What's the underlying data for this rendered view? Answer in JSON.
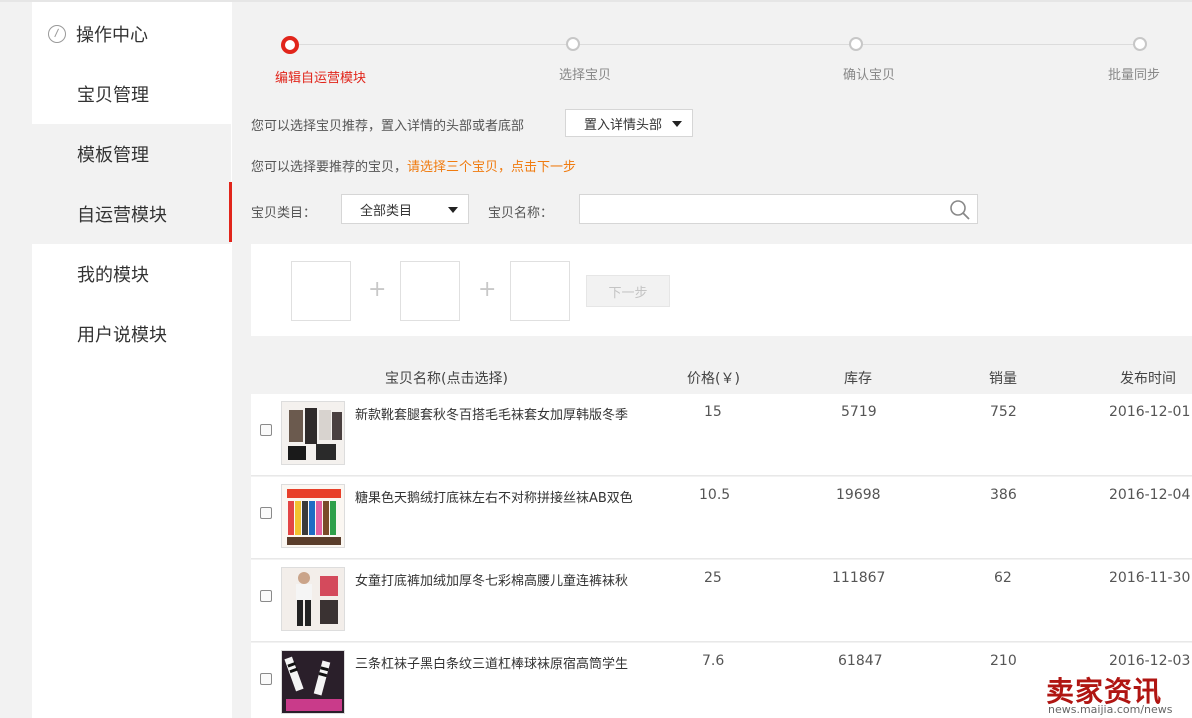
{
  "sidebar": {
    "header": "操作中心",
    "items": [
      {
        "label": "宝贝管理"
      },
      {
        "label": "模板管理"
      },
      {
        "label": "自运营模块"
      },
      {
        "label": "我的模块"
      },
      {
        "label": "用户说模块"
      }
    ],
    "active_item": "自运营模块"
  },
  "steps": [
    {
      "label": "编辑自运营模块",
      "active": true
    },
    {
      "label": "选择宝贝",
      "active": false
    },
    {
      "label": "确认宝贝",
      "active": false
    },
    {
      "label": "批量同步",
      "active": false
    }
  ],
  "placement": {
    "text": "您可以选择宝贝推荐，置入详情的头部或者底部",
    "selected": "置入详情头部"
  },
  "hint": {
    "text": "您可以选择要推荐的宝贝，",
    "highlight": "请选择三个宝贝，点击下一步"
  },
  "filter": {
    "category_label": "宝贝类目：",
    "category_selected": "全部类目",
    "name_label": "宝贝名称：",
    "name_value": ""
  },
  "picker": {
    "plus": "+",
    "next_button": "下一步"
  },
  "table": {
    "headers": {
      "name": "宝贝名称(点击选择)",
      "price": "价格(￥)",
      "stock": "库存",
      "sales": "销量",
      "date": "发布时间"
    },
    "rows": [
      {
        "name": "新款靴套腿套秋冬百搭毛毛袜套女加厚韩版冬季",
        "price": "15",
        "stock": "5719",
        "sales": "752",
        "date": "2016-12-01"
      },
      {
        "name": "糖果色天鹅绒打底袜左右不对称拼接丝袜AB双色",
        "price": "10.5",
        "stock": "19698",
        "sales": "386",
        "date": "2016-12-04"
      },
      {
        "name": "女童打底裤加绒加厚冬七彩棉高腰儿童连裤袜秋",
        "price": "25",
        "stock": "111867",
        "sales": "62",
        "date": "2016-11-30"
      },
      {
        "name": "三条杠袜子黑白条纹三道杠棒球袜原宿高筒学生",
        "price": "7.6",
        "stock": "61847",
        "sales": "210",
        "date": "2016-12-03"
      }
    ]
  },
  "watermark": {
    "brand": "卖家资讯",
    "url": "news.maijia.com/news"
  },
  "colors": {
    "accent": "#e1251b",
    "highlight": "#f07b0f",
    "background": "#f2f2f2"
  }
}
